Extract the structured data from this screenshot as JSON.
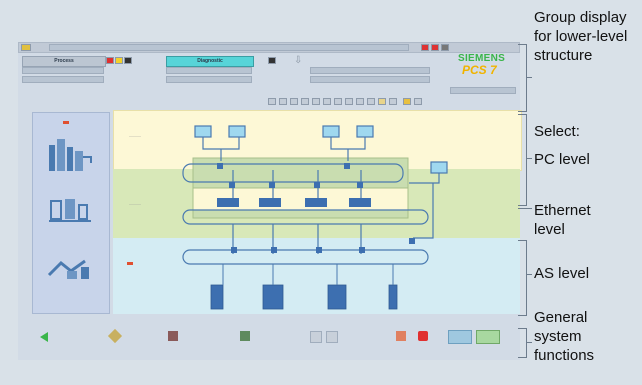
{
  "header": {
    "tab_process": "Process",
    "tab_diagnostic": "Diagnostic",
    "brand_name": "SIEMENS",
    "brand_product": "PCS 7"
  },
  "callouts": {
    "group_display": "Group display for lower-level structure",
    "select": "Select:",
    "pc_level": "PC level",
    "ethernet_level": "Ethernet level",
    "as_level": "AS level",
    "general_functions": "General system functions"
  },
  "colors": {
    "pc_band": "#fdf8d6",
    "ethernet_band": "#d8e8b8",
    "as_band": "#d4ecf3",
    "sidebar": "#c8d4ea",
    "tab_diagnostic": "#57d4d8",
    "brand": "#3ab54a",
    "brand_product": "#f0b400"
  },
  "icons": {
    "nav_back": "green-arrow-left-icon",
    "tool_1": "tool-icon",
    "tool_2": "printer-icon",
    "tool_3": "tree-icon",
    "alarm": "alarm-icon",
    "stop": "stop-icon",
    "next": "arrow-pair-icon"
  }
}
